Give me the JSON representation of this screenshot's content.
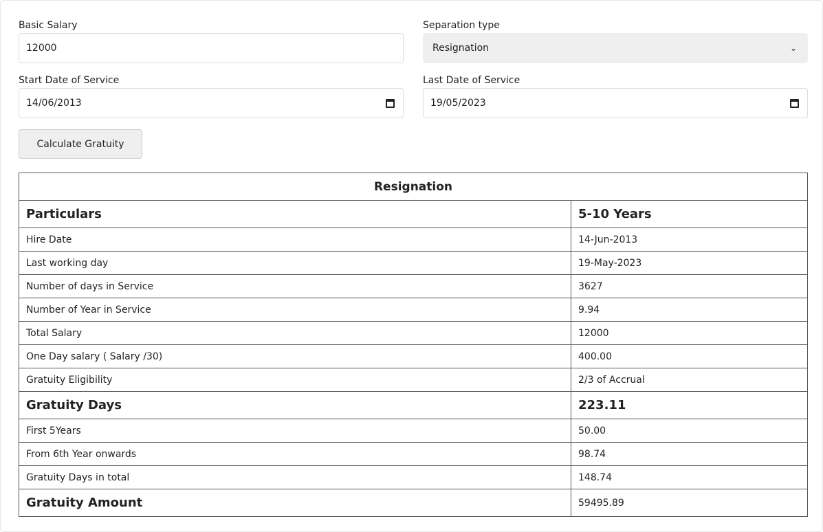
{
  "form": {
    "basic_salary_label": "Basic Salary",
    "basic_salary_value": "12000",
    "separation_type_label": "Separation type",
    "separation_type_value": "Resignation",
    "start_date_label": "Start Date of Service",
    "start_date_value": "14/06/2013",
    "last_date_label": "Last Date of Service",
    "last_date_value": "19/05/2023",
    "calculate_button": "Calculate Gratuity"
  },
  "result": {
    "title": "Resignation",
    "header": {
      "particulars": "Particulars",
      "bracket": "5-10 Years"
    },
    "rows": [
      {
        "label": "Hire Date",
        "value": "14-Jun-2013"
      },
      {
        "label": "Last working day",
        "value": "19-May-2023"
      },
      {
        "label": "Number of days in Service",
        "value": "3627"
      },
      {
        "label": "Number of Year in Service",
        "value": "9.94"
      },
      {
        "label": "Total Salary",
        "value": "12000"
      },
      {
        "label": "One Day salary ( Salary /30)",
        "value": "400.00"
      },
      {
        "label": "Gratuity Eligibility",
        "value": "2/3 of Accrual"
      },
      {
        "label": "Gratuity Days",
        "value": "223.11"
      },
      {
        "label": "First 5Years",
        "value": "50.00"
      },
      {
        "label": "From 6th Year onwards",
        "value": "98.74"
      },
      {
        "label": "Gratuity Days in total",
        "value": "148.74"
      },
      {
        "label": "Gratuity Amount",
        "value": "59495.89"
      }
    ]
  }
}
